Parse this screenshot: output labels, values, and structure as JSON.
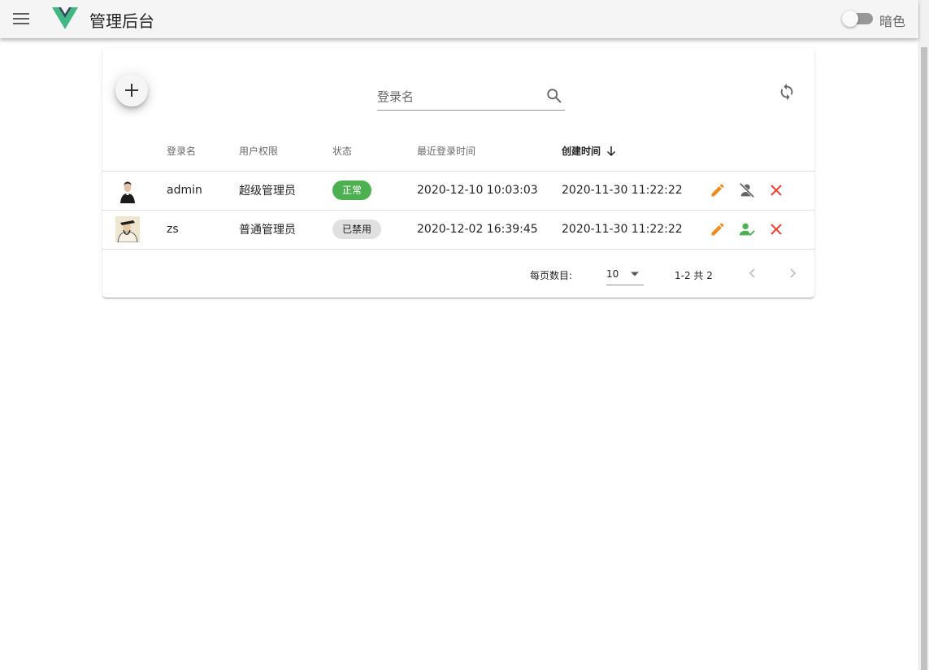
{
  "app": {
    "title": "管理后台",
    "dark_mode_label": "暗色",
    "dark_mode_on": false
  },
  "toolbar": {
    "search_placeholder": "登录名",
    "search_value": ""
  },
  "table": {
    "headers": {
      "login_name": "登录名",
      "role": "用户权限",
      "status": "状态",
      "last_login": "最近登录时间",
      "created": "创建时间"
    },
    "sort": {
      "column": "created",
      "direction": "desc"
    },
    "rows": [
      {
        "login_name": "admin",
        "role": "超级管理员",
        "status": "正常",
        "status_kind": "ok",
        "last_login": "2020-12-10 10:03:03",
        "created": "2020-11-30 11:22:22",
        "toggle_icon": "account-off-icon"
      },
      {
        "login_name": "zs",
        "role": "普通管理员",
        "status": "已禁用",
        "status_kind": "off",
        "last_login": "2020-12-02 16:39:45",
        "created": "2020-11-30 11:22:22",
        "toggle_icon": "account-check-icon"
      }
    ]
  },
  "pagination": {
    "rows_per_page_label": "每页数目:",
    "rows_per_page": "10",
    "range_text": "1-2 共 2"
  },
  "colors": {
    "edit": "#ef8c1e",
    "delete": "#f44336",
    "enable": "#4caf50",
    "status_ok": "#4caf50",
    "status_off": "#e0e0e0",
    "logo_outer": "#41b883",
    "logo_inner": "#35495e"
  }
}
